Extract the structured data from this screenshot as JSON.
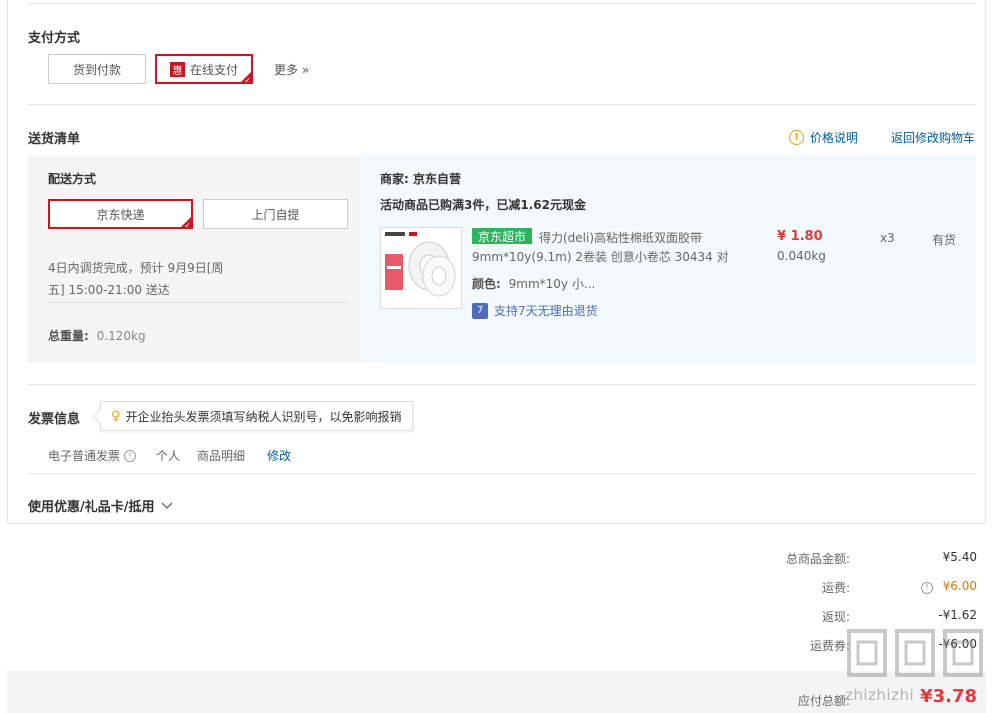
{
  "payment": {
    "title": "支付方式",
    "cod_label": "货到付款",
    "hui_badge": "惠",
    "online_label": "在线支付",
    "more_label": "更多 »"
  },
  "delivery": {
    "title": "送货清单",
    "price_note": "价格说明",
    "back_to_cart": "返回修改购物车",
    "method_title": "配送方式",
    "express_label": "京东快递",
    "pickup_label": "上门自提",
    "eta_line1": "4日内调货完成，预计 9月9日[周",
    "eta_line2": "五] 15:00-21:00 送达",
    "weight_label": "总重量:",
    "weight_value": "0.120kg"
  },
  "merchant": {
    "label": "商家: 京东自营",
    "promo": "活动商品已购满3件，已减1.62元现金",
    "item": {
      "store_badge": "京东超市",
      "name_line1": "得力(deli)高粘性棉纸双面胶带",
      "name_line2": "9mm*10y(9.1m) 2卷装 创意小卷芯 30434 对",
      "color_label": "颜色:",
      "color_value": "9mm*10y 小...",
      "return_badge": "7",
      "return_text": "支持7天无理由退货",
      "price": "¥ 1.80",
      "weight": "0.040kg",
      "qty": "x3",
      "stock": "有货"
    }
  },
  "invoice": {
    "title": "发票信息",
    "tip": "开企业抬头发票须填写纳税人识别号，以免影响报销",
    "type": "电子普通发票",
    "holder": "个人",
    "content": "商品明细",
    "edit": "修改"
  },
  "coupon": {
    "title": "使用优惠/礼品卡/抵用",
    "chevron": "chevron-down-icon"
  },
  "summary": {
    "goods_label": "总商品金额:",
    "goods_value": "¥5.40",
    "shipping_label": "运费:",
    "shipping_value": "¥6.00",
    "rebate_label": "返现:",
    "rebate_value": "-¥1.62",
    "ship_coupon_label": "运费券:",
    "ship_coupon_value": "-¥6.00",
    "payable_label": "应付总额:",
    "payable_value": "¥3.78"
  },
  "watermark": "zhizhizhi",
  "colors": {
    "accent_red": "#c81623",
    "price_red": "#e4393c",
    "link_blue": "#005ea7",
    "store_green": "#2fb35f",
    "panel_bg": "#f3f9fc",
    "left_panel_bg": "#f5f5f5"
  }
}
